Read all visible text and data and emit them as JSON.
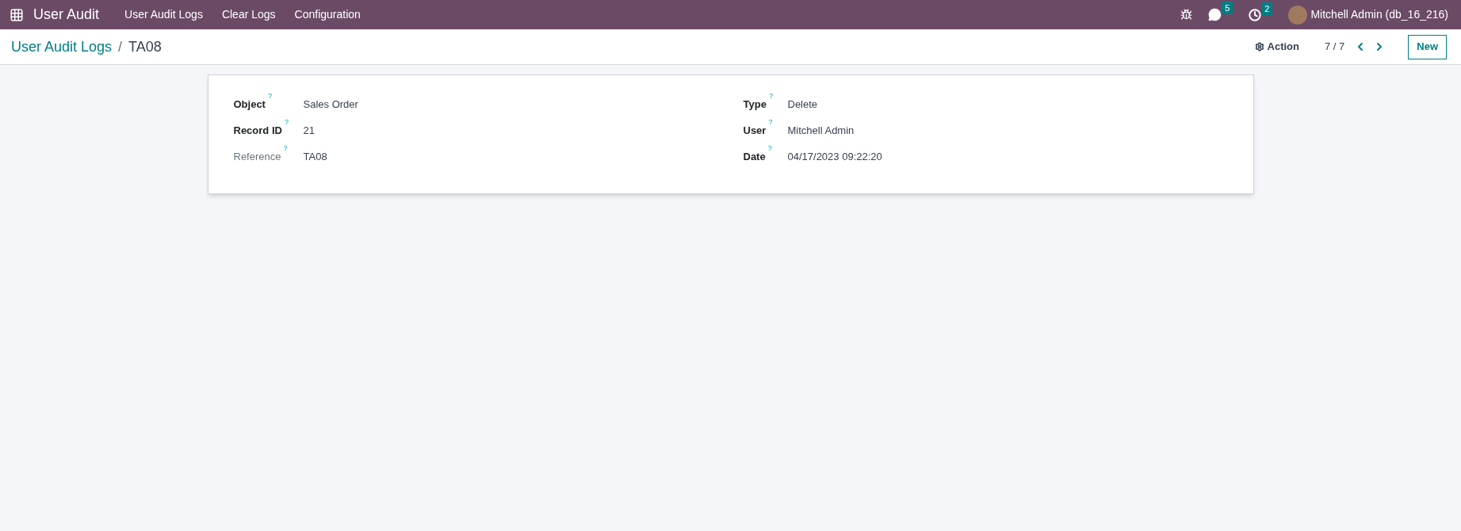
{
  "navbar": {
    "app_name": "User Audit",
    "menu": [
      "User Audit Logs",
      "Clear Logs",
      "Configuration"
    ],
    "messages_count": "5",
    "activities_count": "2",
    "user": "Mitchell Admin (db_16_216)"
  },
  "control_panel": {
    "breadcrumb": "User Audit Logs",
    "separator": "/",
    "current": "TA08",
    "action": "Action",
    "pager": "7 / 7",
    "new_button": "New"
  },
  "form": {
    "columns": [
      [
        {
          "label": "Object",
          "help": "?",
          "value": "Sales Order",
          "muted": false
        },
        {
          "label": "Record ID",
          "help": "?",
          "value": "21",
          "muted": false
        },
        {
          "label": "Reference",
          "help": "?",
          "value": "TA08",
          "muted": true
        }
      ],
      [
        {
          "label": "Type",
          "help": "?",
          "value": "Delete",
          "muted": false
        },
        {
          "label": "User",
          "help": "?",
          "value": "Mitchell Admin",
          "muted": false
        },
        {
          "label": "Date",
          "help": "?",
          "value": "04/17/2023 09:22:20",
          "muted": false
        }
      ]
    ]
  }
}
